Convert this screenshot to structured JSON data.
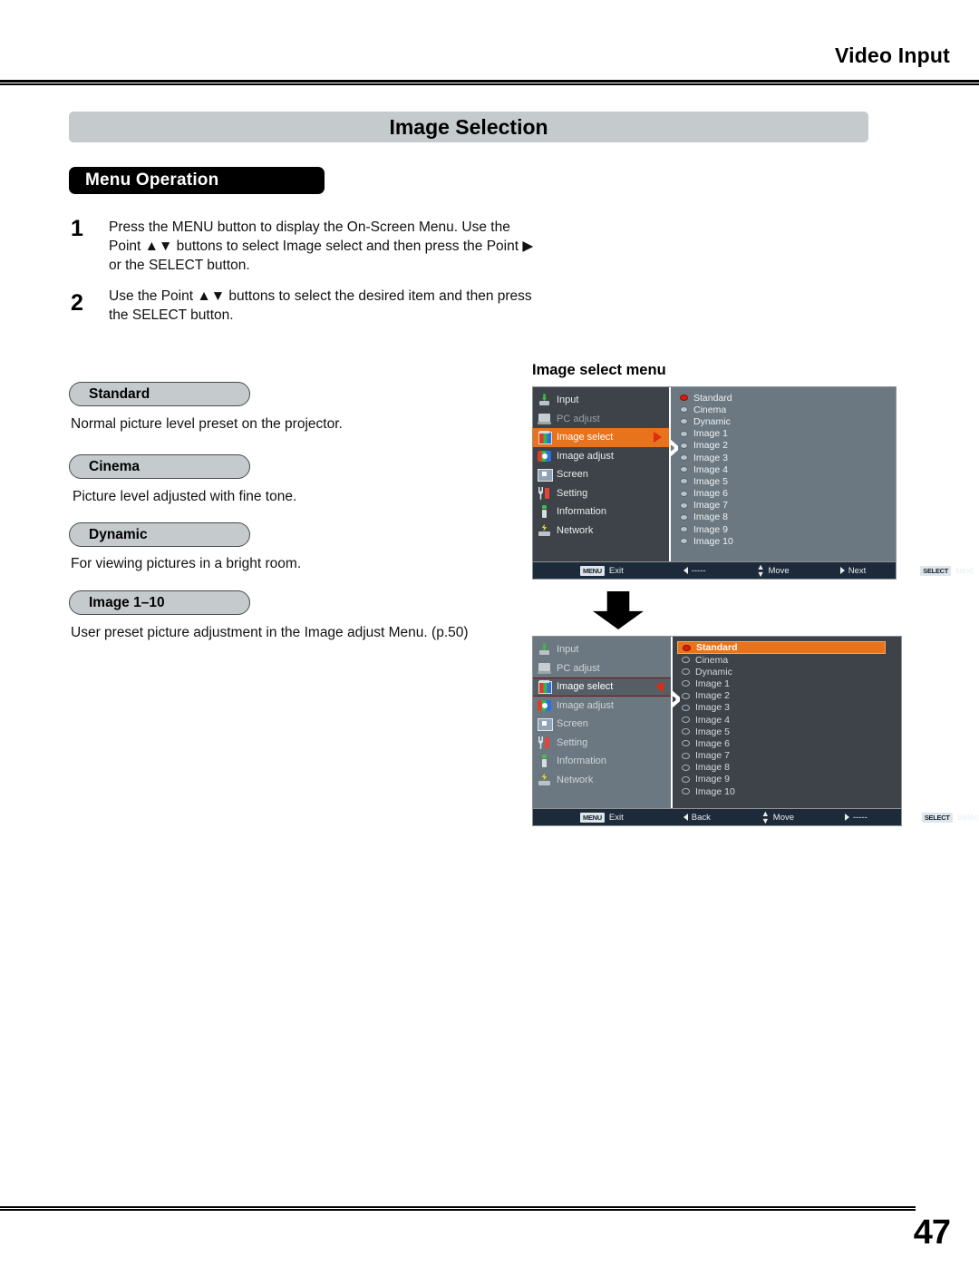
{
  "header": {
    "title": "Video Input"
  },
  "section": {
    "title": "Image Selection"
  },
  "subhead": {
    "label": "Menu Operation"
  },
  "steps": [
    {
      "num": "1",
      "text": "Press the MENU button to display the On-Screen Menu. Use the Point ▲▼ buttons to select Image select and then press the Point ▶ or the SELECT button."
    },
    {
      "num": "2",
      "text": "Use the Point ▲▼ buttons to select the desired item and then press the SELECT button."
    }
  ],
  "terms": [
    {
      "pill": "Standard",
      "desc": "Normal picture level preset on the projector."
    },
    {
      "pill": "Cinema",
      "desc": "Picture level adjusted with fine tone."
    },
    {
      "pill": "Dynamic",
      "desc": "For viewing pictures in a bright room."
    },
    {
      "pill": "Image 1–10",
      "desc": "User preset picture adjustment in the Image adjust Menu. (p.50)"
    }
  ],
  "osd_caption": "Image select menu",
  "osd": {
    "sidebar": [
      {
        "label": "Input",
        "icon": "input-icon"
      },
      {
        "label": "PC adjust",
        "icon": "pc-adjust-icon"
      },
      {
        "label": "Image select",
        "icon": "image-select-icon"
      },
      {
        "label": "Image adjust",
        "icon": "image-adjust-icon"
      },
      {
        "label": "Screen",
        "icon": "screen-icon"
      },
      {
        "label": "Setting",
        "icon": "setting-icon"
      },
      {
        "label": "Information",
        "icon": "information-icon"
      },
      {
        "label": "Network",
        "icon": "network-icon"
      }
    ],
    "items": [
      "Standard",
      "Cinema",
      "Dynamic",
      "Image 1",
      "Image 2",
      "Image 3",
      "Image 4",
      "Image 5",
      "Image 6",
      "Image 7",
      "Image 8",
      "Image 9",
      "Image 10"
    ],
    "guide_top": {
      "exit_key": "MENU",
      "exit": "Exit",
      "back": "-----",
      "move": "Move",
      "next": "Next",
      "select_key": "SELECT",
      "select": "Next"
    },
    "guide_bottom": {
      "exit_key": "MENU",
      "exit": "Exit",
      "back": "Back",
      "move": "Move",
      "next": "-----",
      "select_key": "SELECT",
      "select": "Select"
    }
  },
  "colors": {
    "accent_orange": "#e8731b",
    "panel_dark": "#3d4348",
    "panel_light": "#6b7881",
    "pill_gray": "#c5cacd",
    "guide_bar": "#1c2a3a",
    "bullet_active": "#e01b0d"
  },
  "footer": {
    "page_number": "47"
  }
}
